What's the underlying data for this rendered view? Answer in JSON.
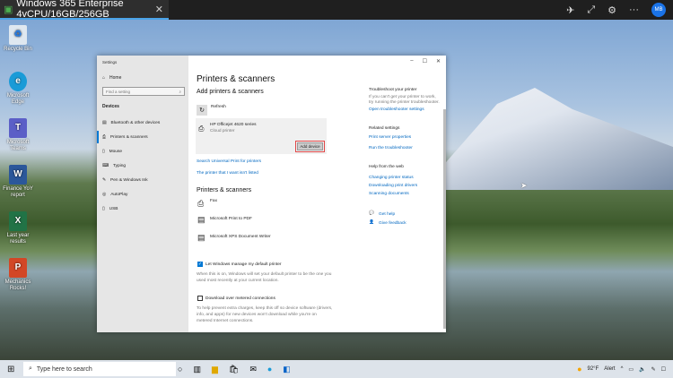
{
  "window_tab": {
    "title": "Windows 365 Enterprise 4vCPU/16GB/256GB",
    "avatar": "MB"
  },
  "desktop_icons": [
    {
      "label": "Recycle Bin",
      "icon": "recycle-bin-icon"
    },
    {
      "label": "Microsoft Edge",
      "icon": "edge-icon"
    },
    {
      "label": "Microsoft Teams",
      "icon": "teams-icon"
    },
    {
      "label": "Finance YoY report",
      "icon": "word-icon"
    },
    {
      "label": "Last year results",
      "icon": "excel-icon"
    },
    {
      "label": "Mechanics Rocks!",
      "icon": "powerpoint-icon"
    }
  ],
  "settings": {
    "title": "Settings",
    "home": "Home",
    "search_placeholder": "Find a setting",
    "section": "Devices",
    "nav": [
      "Bluetooth & other devices",
      "Printers & scanners",
      "Mouse",
      "Typing",
      "Pen & Windows Ink",
      "AutoPlay",
      "USB"
    ],
    "page_title": "Printers & scanners",
    "add_heading": "Add printers & scanners",
    "refresh": "Refresh",
    "found_printer": {
      "name": "HP Officejet 4620 series",
      "type": "Cloud printer",
      "button": "Add device"
    },
    "links": [
      "Search Universal Print for printers",
      "The printer that I want isn't listed"
    ],
    "list_heading": "Printers & scanners",
    "printers": [
      "Fax",
      "Microsoft Print to PDF",
      "Microsoft XPS Document Writer"
    ],
    "default_check": {
      "label": "Let Windows manage my default printer",
      "checked": true,
      "desc1": "When this is on, Windows will set your default printer to be the one you",
      "desc2": "used most recently at your current location."
    },
    "metered_check": {
      "label": "Download over metered connections",
      "checked": false,
      "desc1": "To help prevent extra charges, keep this off so device software (drivers,",
      "desc2": "info, and apps) for new devices won't download while you're on",
      "desc3": "metered Internet connections."
    },
    "right": {
      "troubleshoot_title": "Troubleshoot your printer",
      "troubleshoot_desc1": "If you can't get your printer to work,",
      "troubleshoot_desc2": "try running the printer troubleshooter.",
      "troubleshoot_link": "Open troubleshooter settings",
      "related_title": "Related settings",
      "related": [
        "Print server properties",
        "Run the troubleshooter"
      ],
      "web_title": "Help from the web",
      "web": [
        "Changing printer status",
        "Downloading print drivers",
        "Scanning documents"
      ],
      "get_help": "Get help",
      "feedback": "Give feedback"
    }
  },
  "taskbar": {
    "search_placeholder": "Type here to search",
    "weather": "92°F",
    "alert": "Alert"
  }
}
